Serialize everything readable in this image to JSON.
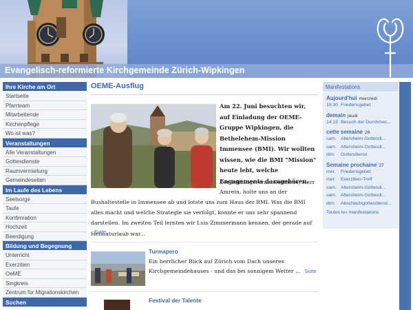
{
  "header": {
    "site_title": "Evangelisch-reformierte Kirchgemeinde Zürich-Wipkingen"
  },
  "nav": [
    {
      "heading": "Ihre Kirche am Ort",
      "items": [
        "Startseite",
        "Pfarrteam",
        "Mitarbeitende",
        "Kirchenpflege",
        "Wo ist was?"
      ]
    },
    {
      "heading": "Veranstaltungen",
      "items": [
        "Alle Veranstaltungen",
        "Gottesdienste",
        "Raumvermietung",
        "Gemeindeseiten"
      ]
    },
    {
      "heading": "Im Laufe des Lebens",
      "items": [
        "Seelsorge",
        "Taufe",
        "Konfirmation",
        "Hochzeit",
        "Beerdigung"
      ]
    },
    {
      "heading": "Bildung und Begegnung",
      "items": [
        "Unterricht",
        "Exerzitien",
        "OeME",
        "Singkreis",
        "Zentrum für Migrationskirchen"
      ]
    },
    {
      "heading": "Suchen",
      "items": []
    }
  ],
  "main": {
    "title": "OEME-Ausflug",
    "lead": "Am 22. Juni besuchten wir, auf Einladung der OEME-Gruppe Wipkingen, die Bethelehem-Mission Immensee (BMI). Wir wollten wissen, wie die BMI \"Mission\" heute lebt, welche Engagements dazugehören.",
    "body_start": "Der Bildungsverantwortliche, Herr Amrein, holte uns an der",
    "body_rest": "Bushaltestelle in Immensee ab und lotste uns zum Haus der BMI. Was die BMI alles macht und welche Strategie sie verfolgt, konnte er uns sehr spannend darstellen. Im zweiten Teil lernten wir Luis Zimmermann kennen, der gerade auf Heimaturlaub war...",
    "more_label": "Suite",
    "teasers": [
      {
        "title": "Turmapero",
        "text": "Ein herrlicher Blick auf Zürich vom Dach unseres Kirchgemeindehauses - und das bei sonnigem Wetter ...",
        "more_label": "Suite"
      },
      {
        "title": "Festival der Talente"
      }
    ]
  },
  "events": {
    "heading": "Manifestations",
    "days": [
      {
        "label": "Aujourd'hui",
        "weekday": "mercredi",
        "rows": [
          {
            "time": "18.30",
            "title": "Friedensgebet"
          }
        ]
      },
      {
        "label": "demain",
        "weekday": "jeudi",
        "rows": [
          {
            "time": "14.15",
            "title": "Besuch der Durchmes..."
          }
        ]
      },
      {
        "label": "cette semaine",
        "weekday": "26",
        "rows": [
          {
            "time": "sam.",
            "title": "Altersheim-Gottesdi..."
          },
          {
            "time": "sam.",
            "title": "Altersheim-Gottesdi..."
          },
          {
            "time": "dim.",
            "title": "Gottesdienst"
          }
        ]
      },
      {
        "label": "Semaine prochaine",
        "weekday": "27",
        "rows": [
          {
            "time": "mer.",
            "title": "Friedensgebet"
          },
          {
            "time": "mer.",
            "title": "Exerzitien-Treff"
          },
          {
            "time": "sam.",
            "title": "Altersheim-Gottesdi..."
          },
          {
            "time": "sam.",
            "title": "Altersheim-Gottesdi..."
          },
          {
            "time": "dim.",
            "title": "Abschiedsgottesdienst..."
          }
        ]
      }
    ],
    "all_label": "Toutes les manifestations"
  }
}
